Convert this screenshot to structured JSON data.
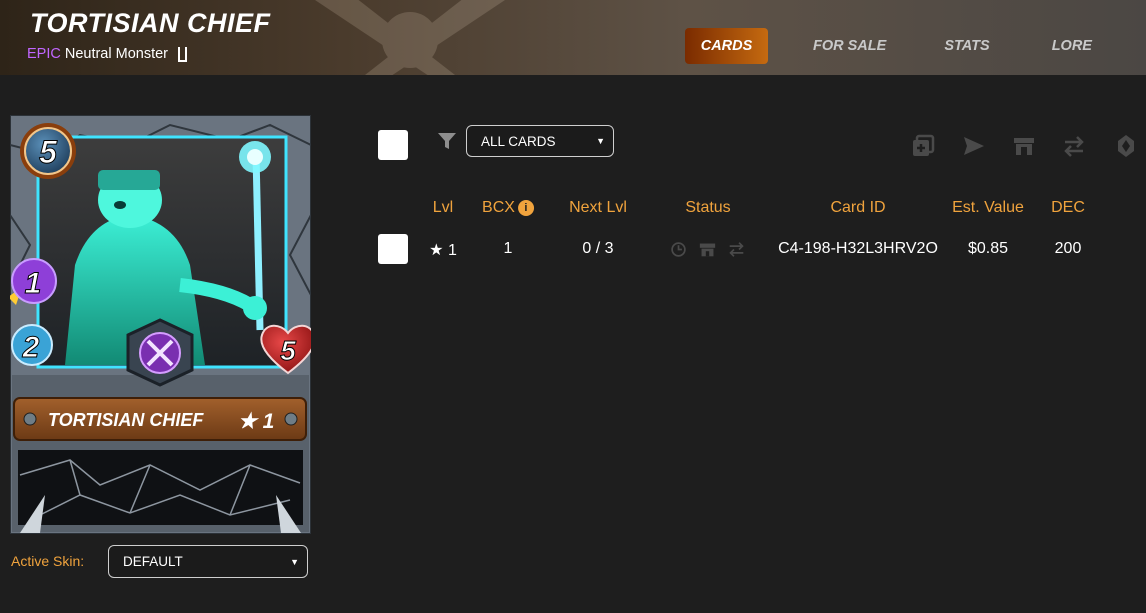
{
  "header": {
    "title": "TORTISIAN CHIEF",
    "rarity": "EPIC",
    "type_text": "Neutral Monster",
    "tabs": [
      "CARDS",
      "FOR SALE",
      "STATS",
      "LORE"
    ]
  },
  "card": {
    "mana": "5",
    "attack": "1",
    "speed": "2",
    "health": "5",
    "name": "TORTISIAN CHIEF",
    "level_label": "★ 1",
    "accent_color": "#2bd2c9",
    "ability_icon": "crossed-swords-icon"
  },
  "skin": {
    "label": "Active Skin:",
    "value": "DEFAULT"
  },
  "filter": {
    "value": "ALL CARDS"
  },
  "actions": [
    "combine-icon",
    "send-icon",
    "market-icon",
    "transfer-icon",
    "burn-icon"
  ],
  "table": {
    "headers": {
      "lvl": "Lvl",
      "bcx": "BCX",
      "next_lvl": "Next Lvl",
      "status": "Status",
      "card_id": "Card ID",
      "est_value": "Est. Value",
      "dec": "DEC"
    },
    "rows": [
      {
        "lvl": "★ 1",
        "bcx": "1",
        "next_lvl": "0 / 3",
        "status_icons": [
          "clock-icon",
          "market-icon",
          "transfer-icon"
        ],
        "card_id": "C4-198-H32L3HRV2O",
        "est_value": "$0.85",
        "dec": "200"
      }
    ]
  },
  "colors": {
    "accent_orange": "#f0a33d",
    "epic_purple": "#c166ff",
    "active_tab": "#c56a10"
  }
}
